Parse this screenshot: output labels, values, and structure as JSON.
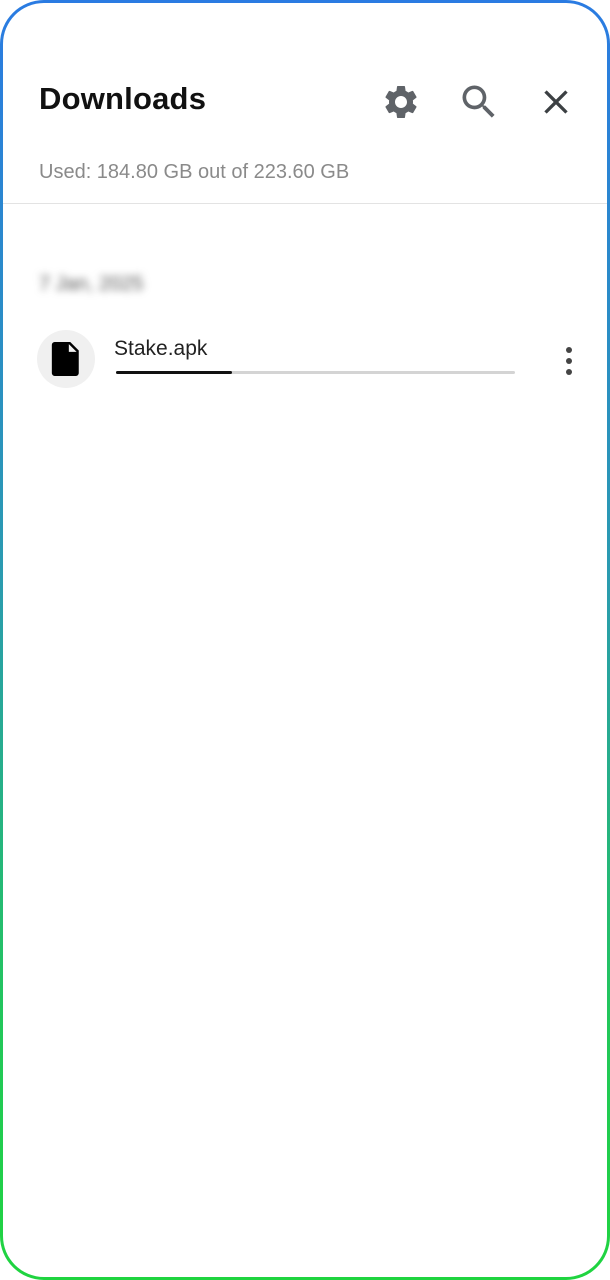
{
  "header": {
    "title": "Downloads",
    "storage_text": "Used: 184.80 GB out of 223.60 GB"
  },
  "icons": {
    "settings": "gear-icon",
    "search": "search-icon",
    "close": "close-icon",
    "file": "file-icon",
    "more": "more-vertical-icon"
  },
  "colors": {
    "frame_top": "#2a7be2",
    "frame_bottom": "#1fd43f",
    "progress": "#111111",
    "track": "#d4d4d4"
  },
  "downloads": {
    "section_date": "7 Jan, 2025",
    "items": [
      {
        "name": "Stake.apk",
        "progress": 0.29
      }
    ]
  }
}
